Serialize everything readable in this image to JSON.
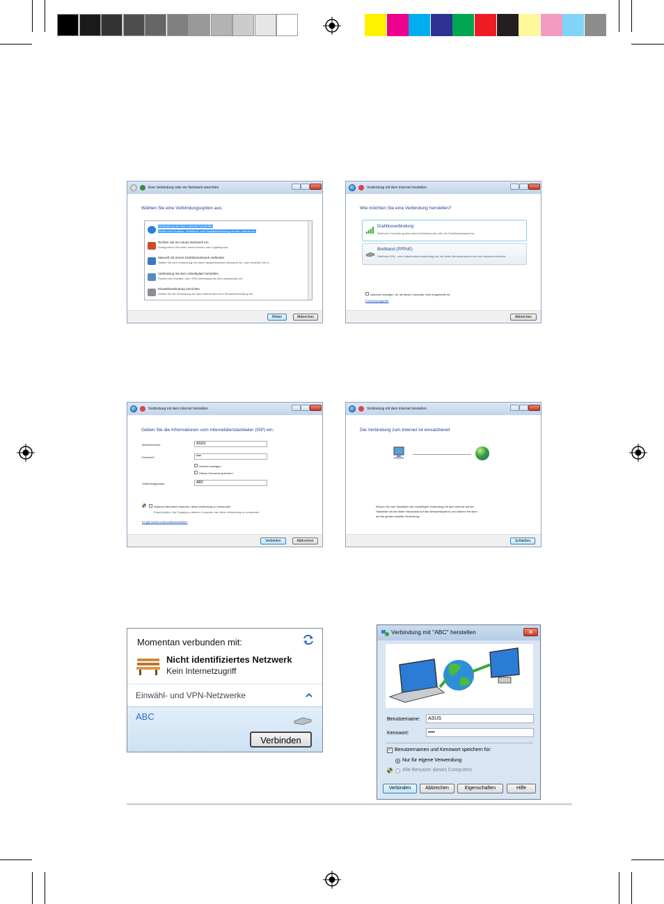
{
  "colors": {
    "gray_bar": [
      "#000000",
      "#1a1a1a",
      "#333333",
      "#4d4d4d",
      "#666666",
      "#808080",
      "#999999",
      "#b3b3b3",
      "#cccccc",
      "#e6e6e6",
      "#ffffff"
    ],
    "color_bar": [
      "#fff200",
      "#ec008c",
      "#00aeef",
      "#2e3192",
      "#00a651",
      "#ed1c24",
      "#231f20",
      "#fff799",
      "#f49ac1",
      "#7fd4f7",
      "#8c8c8c"
    ],
    "title_blue": "#1e3d8f",
    "accent": "#3c7fb1"
  },
  "screen1": {
    "title": "Eine Verbindung oder ein Netzwerk einrichten",
    "heading": "Wählen Sie eine Verbindungsoption aus:",
    "options": [
      {
        "title": "Verbindung mit dem Internet herstellen",
        "desc": "Richtet eine Drahtlos-, Breitband- oder Einwählverbindung mit dem Internet ein.",
        "icon": "globe-icon"
      },
      {
        "title": "Richten Sie ein neues Netzwerk ein.",
        "desc": "Konfigurieren Sie einen neuen Router oder Zugriffspunkt.",
        "icon": "router-icon"
      },
      {
        "title": "Manuell mit einem Drahtlosnetzwerk verbinden",
        "desc": "Stellen Sie eine Verbindung mit einem ausgeblendeten Netzwerk her, oder erstellen Sie ei...",
        "icon": "wireless-icon"
      },
      {
        "title": "Verbindung mit dem Arbeitsplatz herstellen",
        "desc": "Richtet eine Einwähl- oder VPN-Verbindung mit dem Arbeitsplatz ein.",
        "icon": "workplace-icon"
      },
      {
        "title": "Einwählverbindung einrichten",
        "desc": "Stellen Sie die Verbindung mit dem Internet über eine Einwählverbindung her.",
        "icon": "phone-icon"
      }
    ],
    "next_button": "Weiter",
    "cancel_button": "Abbrechen"
  },
  "screen2": {
    "title": "Verbindung mit dem Internet herstellen",
    "heading": "Wie möchten Sie eine Verbindung herstellen?",
    "options": [
      {
        "title": "Drahtlosverbindung",
        "desc": "Stellt eine Verbindung über einen Drahtlosrouter oder ein Drahtlosnetzwerk her."
      },
      {
        "title": "Breitband (PPPoE)",
        "desc": "Stellt eine DSL- oder Kabelmodemverbindung her, die einen Benutzernamen und ein Kennwort erfordert."
      }
    ],
    "show_options_label": "Optionen anzeigen, für die dieser Computer nicht eingerichtet ist",
    "help_link": "Entscheidungshilfe",
    "cancel_button": "Abbrechen"
  },
  "screen3": {
    "title": "Verbindung mit dem Internet herstellen",
    "heading": "Geben Sie die Informationen vom Internetdienstanbieter (ISP) ein.",
    "username_label": "Benutzername:",
    "username_value": "ASUS",
    "password_label": "Kennwort:",
    "password_value": "••••",
    "show_chars_label": "Zeichen anzeigen",
    "remember_label": "Dieses Kennwort speichern",
    "connection_name_label": "Verbindungsname:",
    "connection_name_value": "ABC",
    "allow_others_label": "Anderen Benutzern erlauben, diese Verbindung zu verwenden",
    "allow_others_desc": "Erlaubt jedem, der Zugang zu diesem Computer hat, diese Verbindung zu verwenden.",
    "no_isp_link": "Es gibt keinen Internetdienstanbieter.",
    "connect_button": "Verbinden",
    "cancel_button": "Abbrechen"
  },
  "screen4": {
    "title": "Verbindung mit dem Internet herstellen",
    "heading": "Die Verbindung zum Internet ist einsatzbereit",
    "message": [
      "Klicken Sie zum Herstellen der zukünftigen Verbindung mit dem Internet auf der",
      "Taskleiste mit der linken Maustaste auf das Netzwerksymbol, und klicken Sie dann",
      "auf die gerade erstellte Verbindung."
    ],
    "close_button": "Schließen"
  },
  "screen5": {
    "header": "Momentan verbunden mit:",
    "network_name": "Nicht identifiziertes Netzwerk",
    "network_status": "Kein Internetzugriff",
    "section": "Einwähl- und VPN-Netzwerke",
    "connection": "ABC",
    "connect_button": "Verbinden"
  },
  "screen6": {
    "title": "Verbindung mit \"ABC\" herstellen",
    "username_label": "Benutzername:",
    "username_value": "ASUS",
    "password_label": "Kennwort:",
    "password_value": "••••",
    "save_label": "Benutzernamen und Kennwort speichern für:",
    "radio_me": "Nur für eigene Verwendung",
    "radio_all": "Alle Benutzer dieses Computers",
    "buttons": [
      "Verbinden",
      "Abbrechen",
      "Eigenschaften",
      "Hilfe"
    ]
  }
}
